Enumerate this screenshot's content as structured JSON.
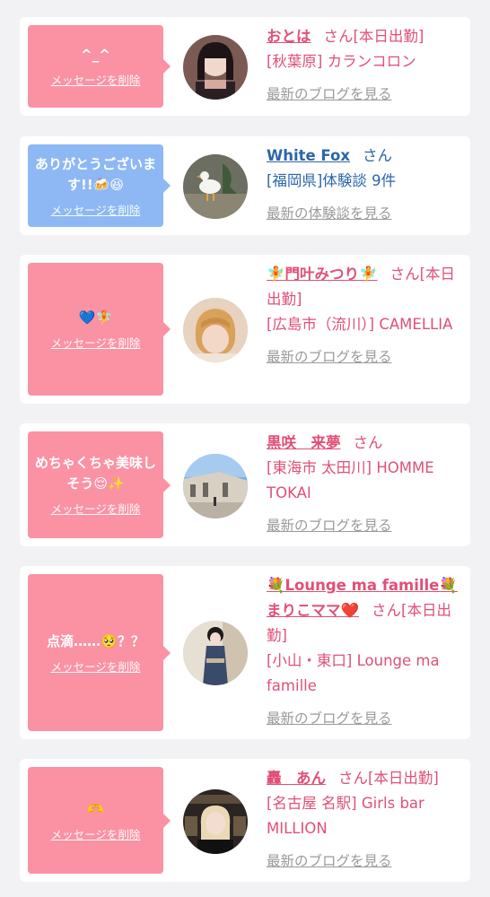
{
  "theme": {
    "pink": "#fb92a4",
    "blue": "#8db8f4",
    "name_pink": "#e05077",
    "name_blue": "#2c66a8",
    "link_gray": "#9a9a9a"
  },
  "cards": [
    {
      "message": "^_^",
      "delete_label": "メッセージを削除",
      "name": "おとは",
      "san": "さん",
      "status": "[本日出勤]",
      "location": "[秋葉原] カランコロン",
      "more_link": "最新のブログを見る"
    },
    {
      "message": "ありがとうございます!!🍻😆",
      "delete_label": "メッセージを削除",
      "name": "White Fox",
      "san": "さん",
      "location": "[福岡県]体験談 9件",
      "more_link": "最新の体験談を見る"
    },
    {
      "message": "💙🧚",
      "delete_label": "メッセージを削除",
      "name": "🧚門叶みつり🧚",
      "san": "さん",
      "status": "[本日出勤]",
      "location": "[広島市（流川）] CAMELLIA",
      "more_link": "最新のブログを見る"
    },
    {
      "message": "めちゃくちゃ美味しそう😌✨",
      "delete_label": "メッセージを削除",
      "name": "黒咲　来夢",
      "san": "さん",
      "location": "[東海市 太田川] HOMME TOKAI",
      "more_link": "最新のブログを見る"
    },
    {
      "message": "点滴……🥺？？",
      "delete_label": "メッセージを削除",
      "name": "💐Lounge ma famille💐まりこママ❤️",
      "san": "さん",
      "status": "[本日出勤]",
      "location": "[小山・東口] Lounge ma famille",
      "more_link": "最新のブログを見る"
    },
    {
      "message": "🫶",
      "delete_label": "メッセージを削除",
      "name": "轟　あん",
      "san": "さん",
      "status": "[本日出勤]",
      "location": "[名古屋 名駅] Girls bar MILLION",
      "more_link": "最新のブログを見る"
    }
  ]
}
